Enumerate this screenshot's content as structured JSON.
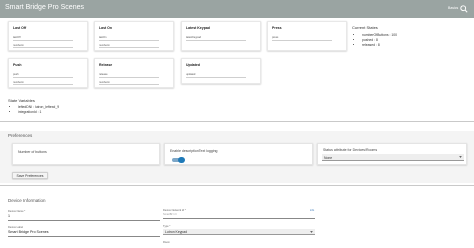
{
  "app": {
    "title": "Smart Bridge Pro Scenes",
    "menu_label": "Basics",
    "search_icon": "search-icon"
  },
  "commands": [
    {
      "title": "Last Off",
      "args": [
        "lastOff",
        "numberm"
      ]
    },
    {
      "title": "Last On",
      "args": [
        "lastOn",
        "numberm"
      ]
    },
    {
      "title": "Latest Keypad",
      "args": [
        "latestKeypad"
      ]
    },
    {
      "title": "Press",
      "args": [
        "press"
      ]
    },
    {
      "title": "Push",
      "args": [
        "push",
        "numberm"
      ]
    },
    {
      "title": "Release",
      "args": [
        "release",
        "numberm"
      ]
    },
    {
      "title": "Updated",
      "args": [
        "updated"
      ]
    }
  ],
  "current_states": {
    "heading": "Current States",
    "items": [
      "numberOfButtons : 100",
      "pushed : 8",
      "released : 8"
    ]
  },
  "state_variables": {
    "heading": "State Variables",
    "items": [
      "leftedDNI : lutron_leftexd_9",
      "integrationId : 1"
    ]
  },
  "preferences": {
    "heading": "Preferences",
    "number_of_buttons_label": "Number of buttons",
    "desc_logging_label": "Enable descriptionText logging",
    "desc_logging_enabled": true,
    "status_attr_label": "Status attribute for Devices/Rooms",
    "status_attr_value": "None",
    "save_button": "Save Preferences"
  },
  "device_information": {
    "heading": "Device Information",
    "device_name_label": "Device Name *",
    "device_name_value": "1",
    "device_label_label": "Device Label",
    "device_label_value": "Smart Bridge Pro Scenes",
    "network_id_label": "Device Network Id *",
    "network_id_value": "SmartBr:1 Ir",
    "type_label": "Type *",
    "type_value": "Lutron Keypad",
    "room_label": "Room",
    "info_label": "info"
  },
  "colors": {
    "topbar": "#9aa4a2",
    "toggle_on": "#1f7ab8",
    "background": "#ffffff"
  }
}
